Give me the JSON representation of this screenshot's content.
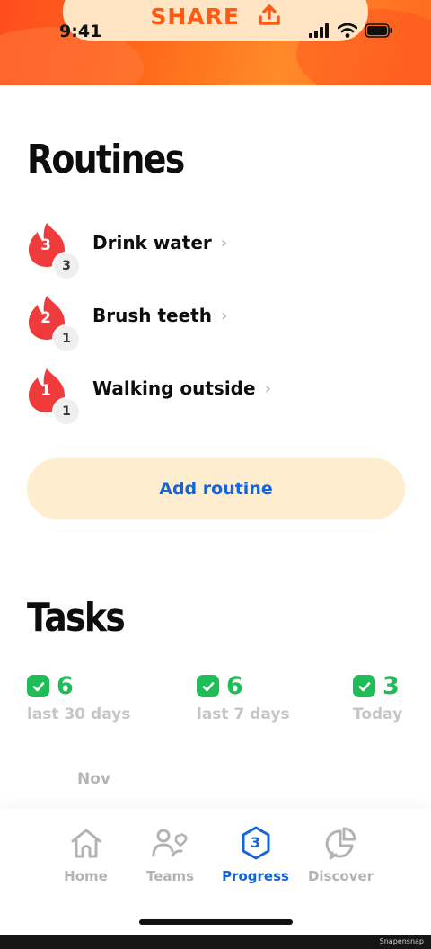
{
  "status_bar": {
    "time": "9:41"
  },
  "hero": {
    "share_label": "SHARE"
  },
  "routines": {
    "title": "Routines",
    "items": [
      {
        "streak": "3",
        "count": "3",
        "name": "Drink water"
      },
      {
        "streak": "2",
        "count": "1",
        "name": "Brush teeth"
      },
      {
        "streak": "1",
        "count": "1",
        "name": "Walking outside"
      }
    ],
    "add_label": "Add routine"
  },
  "tasks": {
    "title": "Tasks",
    "stats": [
      {
        "value": "6",
        "label": "last 30 days"
      },
      {
        "value": "6",
        "label": "last 7 days"
      },
      {
        "value": "3",
        "label": "Today"
      }
    ],
    "month": "Nov"
  },
  "tab_bar": {
    "tabs": [
      {
        "label": "Home"
      },
      {
        "label": "Teams"
      },
      {
        "label": "Progress",
        "badge": "3"
      },
      {
        "label": "Discover"
      }
    ]
  },
  "footer": {
    "watermark": "Snapensnap"
  },
  "colors": {
    "accent_orange": "#ff5b14",
    "flame_red": "#ef3b3b",
    "link_blue": "#1565d8",
    "success_green": "#1fbd57",
    "button_bg": "#ffedcf"
  },
  "icons": [
    "share-upload-icon",
    "signal-icon",
    "wifi-icon",
    "battery-icon",
    "flame-icon",
    "chevron-right-icon",
    "check-icon",
    "home-icon",
    "teams-icon",
    "progress-icon",
    "discover-icon"
  ]
}
